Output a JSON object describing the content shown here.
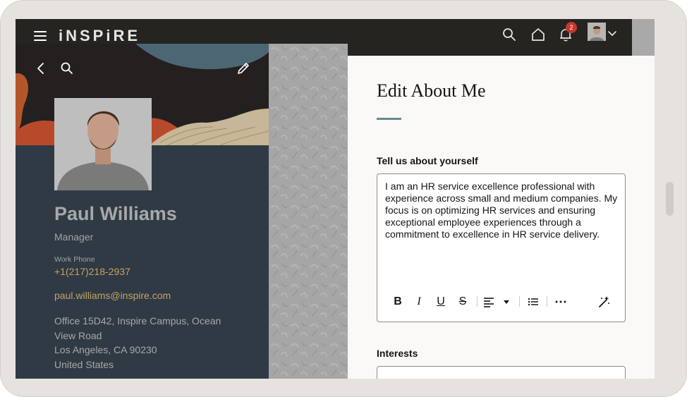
{
  "app": {
    "logo": "iNSPiRE",
    "notification_count": "2"
  },
  "profile": {
    "name": "Paul Williams",
    "job_title": "Manager",
    "work_phone_label": "Work Phone",
    "work_phone": "+1(217)218-2937",
    "email": "paul.williams@inspire.com",
    "address_lines": [
      "Office 15D42, Inspire Campus, Ocean",
      "View Road",
      "Los Angeles, CA 90230",
      "United States"
    ]
  },
  "drawer": {
    "title": "Edit About Me",
    "about_label": "Tell us about yourself",
    "about_text": "I am an HR service excellence professional with experience across small and medium companies. My focus is on optimizing HR services and ensuring exceptional employee experiences through a commitment to excellence in HR service delivery.",
    "interests_label": "Interests",
    "interests_value": ""
  },
  "toolbar": {
    "bold": "B",
    "italic": "I",
    "underline": "U",
    "strike": "S",
    "more": "⋯"
  },
  "icons": {
    "menu": "hamburger-menu-icon",
    "search": "search-icon",
    "home": "home-icon",
    "notifications": "bell-icon",
    "back": "chevron-left-icon",
    "edit": "pencil-icon",
    "magic": "magic-wand-icon"
  },
  "colors": {
    "topbar": "#262421",
    "profile_panel": "#2f3a45",
    "accent_gold": "#c4a166",
    "title_rule": "#688a8f",
    "badge": "#c7372c"
  }
}
